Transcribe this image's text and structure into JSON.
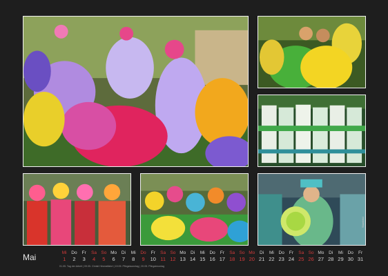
{
  "photos": [
    {
      "name": "photo-parade-float-flowers"
    },
    {
      "name": "photo-girls-green-yellow-dresses"
    },
    {
      "name": "photo-dancers-green-costumes"
    },
    {
      "name": "photo-women-flower-headdresses"
    },
    {
      "name": "photo-colorful-crowd-costumes"
    },
    {
      "name": "photo-woman-with-flower-basket"
    }
  ],
  "credit": "Stumbild",
  "calendar": {
    "month": "Mai",
    "days": [
      {
        "wd": "Mi",
        "d": "1",
        "hol": true
      },
      {
        "wd": "Do",
        "d": "2",
        "hol": false
      },
      {
        "wd": "Fr",
        "d": "3",
        "hol": false
      },
      {
        "wd": "Sa",
        "d": "4",
        "hol": true
      },
      {
        "wd": "So",
        "d": "5",
        "hol": true
      },
      {
        "wd": "Mo",
        "d": "6",
        "hol": false
      },
      {
        "wd": "Di",
        "d": "7",
        "hol": false
      },
      {
        "wd": "Mi",
        "d": "8",
        "hol": false
      },
      {
        "wd": "Do",
        "d": "9",
        "hol": true
      },
      {
        "wd": "Fr",
        "d": "10",
        "hol": false
      },
      {
        "wd": "Sa",
        "d": "11",
        "hol": true
      },
      {
        "wd": "So",
        "d": "12",
        "hol": true
      },
      {
        "wd": "Mo",
        "d": "13",
        "hol": false
      },
      {
        "wd": "Di",
        "d": "14",
        "hol": false
      },
      {
        "wd": "Mi",
        "d": "15",
        "hol": false
      },
      {
        "wd": "Do",
        "d": "16",
        "hol": false
      },
      {
        "wd": "Fr",
        "d": "17",
        "hol": false
      },
      {
        "wd": "Sa",
        "d": "18",
        "hol": true
      },
      {
        "wd": "So",
        "d": "19",
        "hol": true
      },
      {
        "wd": "Mo",
        "d": "20",
        "hol": true
      },
      {
        "wd": "Di",
        "d": "21",
        "hol": false
      },
      {
        "wd": "Mi",
        "d": "22",
        "hol": false
      },
      {
        "wd": "Do",
        "d": "23",
        "hol": false
      },
      {
        "wd": "Fr",
        "d": "24",
        "hol": false
      },
      {
        "wd": "Sa",
        "d": "25",
        "hol": true
      },
      {
        "wd": "So",
        "d": "26",
        "hol": true
      },
      {
        "wd": "Mo",
        "d": "27",
        "hol": false
      },
      {
        "wd": "Di",
        "d": "28",
        "hol": false
      },
      {
        "wd": "Mi",
        "d": "29",
        "hol": false
      },
      {
        "wd": "Do",
        "d": "30",
        "hol": false
      },
      {
        "wd": "Fr",
        "d": "31",
        "hol": false
      }
    ],
    "notes": "01.05. Tag der Arbeit | 09.05. Christi Himmelfahrt | 19.05. Pfingstsonntag | 20.05. Pfingstmontag"
  },
  "colors": {
    "background": "#1e1e1e",
    "holiday": "#d33b3b",
    "weekday": "#d9d9d9"
  }
}
